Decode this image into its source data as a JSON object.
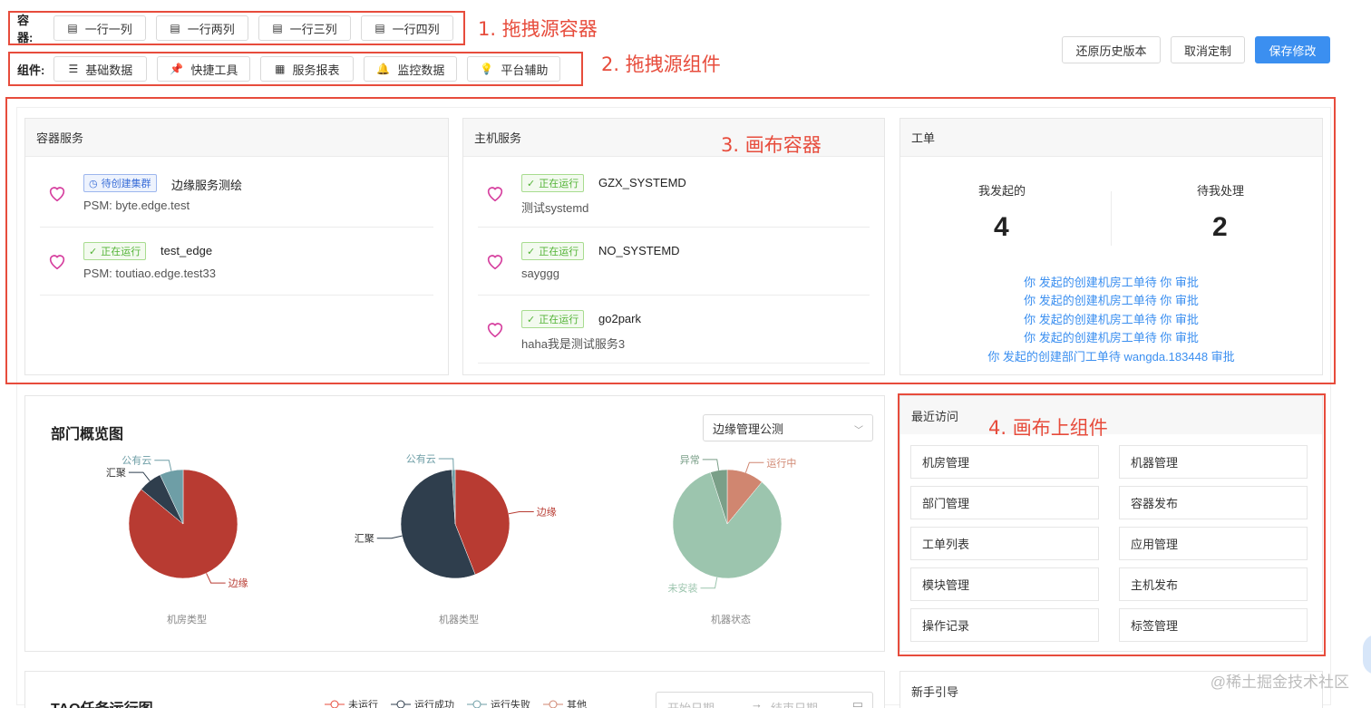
{
  "toolbar": {
    "container_label": "容器:",
    "container_buttons": [
      "一行一列",
      "一行两列",
      "一行三列",
      "一行四列"
    ],
    "component_label": "组件:",
    "component_buttons": [
      "基础数据",
      "快捷工具",
      "服务报表",
      "监控数据",
      "平台辅助"
    ]
  },
  "annotations": {
    "a1": "1. 拖拽源容器",
    "a2": "2. 拖拽源组件",
    "a3": "3. 画布容器",
    "a4": "4. 画布上组件"
  },
  "header_actions": {
    "restore": "还原历史版本",
    "cancel": "取消定制",
    "save": "保存修改"
  },
  "container_service": {
    "title": "容器服务",
    "items": [
      {
        "tag": "待创建集群",
        "name": "边缘服务测绘",
        "sub": "PSM: byte.edge.test"
      },
      {
        "tag": "正在运行",
        "name": "test_edge",
        "sub": "PSM: toutiao.edge.test33"
      }
    ]
  },
  "host_service": {
    "title": "主机服务",
    "items": [
      {
        "tag": "正在运行",
        "name": "GZX_SYSTEMD",
        "sub": "测试systemd"
      },
      {
        "tag": "正在运行",
        "name": "NO_SYSTEMD",
        "sub": "sayggg"
      },
      {
        "tag": "正在运行",
        "name": "go2park",
        "sub": "haha我是测试服务3"
      }
    ]
  },
  "work_order": {
    "title": "工单",
    "initiated_label": "我发起的",
    "initiated_count": "4",
    "pending_label": "待我处理",
    "pending_count": "2",
    "links": [
      "你 发起的创建机房工单待 你 审批",
      "你 发起的创建机房工单待 你 审批",
      "你 发起的创建机房工单待 你 审批",
      "你 发起的创建机房工单待 你 审批",
      "你 发起的创建部门工单待 wangda.183448 审批"
    ]
  },
  "dept_overview": {
    "title": "部门概览图",
    "select_value": "边缘管理公测",
    "captions": [
      "机房类型",
      "机器类型",
      "机器状态"
    ]
  },
  "chart_data": [
    {
      "type": "pie",
      "title": "机房类型",
      "labels": [
        "边缘",
        "汇聚",
        "公有云"
      ],
      "values": [
        86,
        7,
        7
      ],
      "colors": [
        "#b83b32",
        "#2f3e4d",
        "#6e9ea6"
      ]
    },
    {
      "type": "pie",
      "title": "机器类型",
      "labels": [
        "边缘",
        "汇聚",
        "公有云"
      ],
      "values": [
        44,
        55,
        1
      ],
      "colors": [
        "#b83b32",
        "#2f3e4d",
        "#6e9ea6"
      ]
    },
    {
      "type": "pie",
      "title": "机器状态",
      "labels": [
        "运行中",
        "未安装",
        "异常"
      ],
      "values": [
        11,
        84,
        5
      ],
      "colors": [
        "#d08670",
        "#9cc5ae",
        "#7a9f88"
      ]
    }
  ],
  "recent": {
    "title": "最近访问",
    "items": [
      "机房管理",
      "机器管理",
      "部门管理",
      "容器发布",
      "工单列表",
      "应用管理",
      "模块管理",
      "主机发布",
      "操作记录",
      "标签管理"
    ]
  },
  "tao": {
    "title": "TAO任务运行图",
    "legend": [
      "未运行",
      "运行成功",
      "运行失败",
      "其他"
    ],
    "legend_colors": [
      "#e74c3c",
      "#2f3e4d",
      "#6e9ea6",
      "#d08670"
    ],
    "start_placeholder": "开始日期",
    "end_placeholder": "结束日期"
  },
  "guide": {
    "title": "新手引导"
  },
  "watermark": "@稀土掘金技术社区",
  "colors": {
    "primary": "#3b8ff0",
    "annotation": "#e74c3c"
  }
}
